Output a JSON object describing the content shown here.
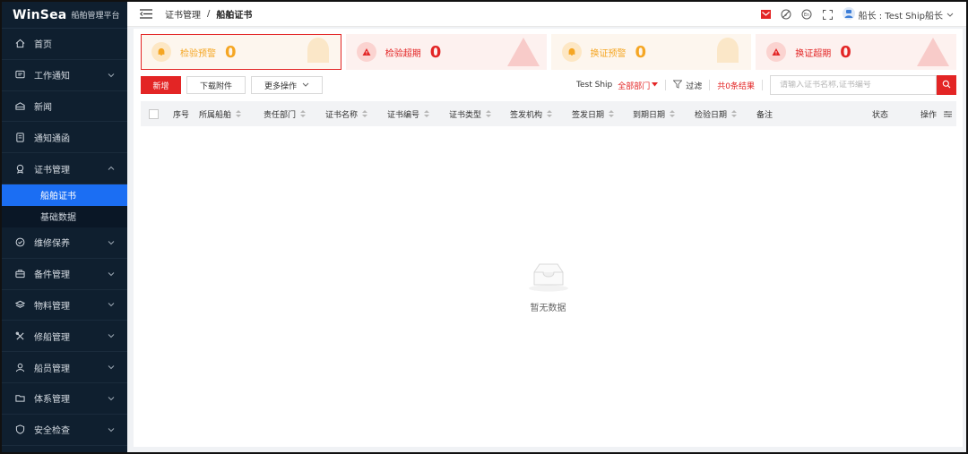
{
  "logo": {
    "brand": "WinSea",
    "subtitle": "船舶管理平台"
  },
  "sidebar": {
    "items": [
      {
        "label": "首页",
        "icon": "home-icon",
        "has_chevron": false
      },
      {
        "label": "工作通知",
        "icon": "message-icon",
        "has_chevron": true
      },
      {
        "label": "新闻",
        "icon": "news-icon",
        "has_chevron": false
      },
      {
        "label": "通知通函",
        "icon": "notice-icon",
        "has_chevron": false
      },
      {
        "label": "证书管理",
        "icon": "certificate-icon",
        "has_chevron": true,
        "expanded": true
      }
    ],
    "subitems": [
      {
        "label": "船舶证书",
        "active": true
      },
      {
        "label": "基础数据",
        "active": false
      }
    ],
    "items_after": [
      {
        "label": "维修保养",
        "icon": "check-circle-icon"
      },
      {
        "label": "备件管理",
        "icon": "briefcase-icon"
      },
      {
        "label": "物料管理",
        "icon": "layers-icon"
      },
      {
        "label": "修船管理",
        "icon": "tools-icon"
      },
      {
        "label": "船员管理",
        "icon": "user-icon"
      },
      {
        "label": "体系管理",
        "icon": "folder-icon"
      },
      {
        "label": "安全检查",
        "icon": "shield-icon"
      }
    ]
  },
  "header": {
    "breadcrumb_parent": "证书管理",
    "breadcrumb_sep": "/",
    "breadcrumb_current": "船舶证书",
    "user_label": "船长 : Test Ship船长"
  },
  "stats": [
    {
      "label": "检验预警",
      "value": "0",
      "kind": "warn",
      "selected": true,
      "icon": "bell-icon"
    },
    {
      "label": "检验超期",
      "value": "0",
      "kind": "danger",
      "selected": false,
      "icon": "alert-triangle-icon"
    },
    {
      "label": "换证预警",
      "value": "0",
      "kind": "warn",
      "selected": false,
      "icon": "bell-icon"
    },
    {
      "label": "换证超期",
      "value": "0",
      "kind": "danger",
      "selected": false,
      "icon": "alert-triangle-icon"
    }
  ],
  "toolbar": {
    "new_label": "新增",
    "download_label": "下载附件",
    "more_label": "更多操作",
    "ship_label": "Test Ship",
    "dept_label": "全部部门",
    "filter_label": "过滤",
    "result_label": "共0条结果",
    "search_placeholder": "请输入证书名称,证书编号"
  },
  "table": {
    "columns": [
      "序号",
      "所属船舶",
      "责任部门",
      "证书名称",
      "证书编号",
      "证书类型",
      "签发机构",
      "签发日期",
      "到期日期",
      "检验日期",
      "备注",
      "状态",
      "操作"
    ]
  },
  "empty": {
    "text": "暂无数据"
  },
  "colors": {
    "accent": "#e32525",
    "warn": "#f5a623",
    "sidebar_bg": "#0f1f2f",
    "active": "#1b6ef3"
  }
}
